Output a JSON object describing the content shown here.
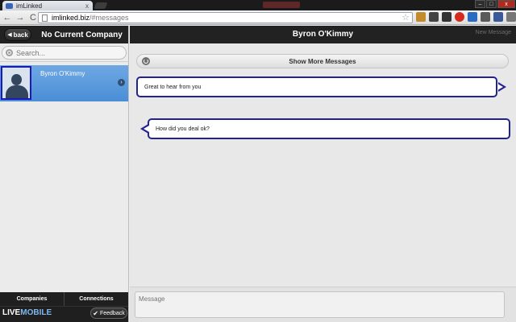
{
  "browser": {
    "tab_title": "imLinked",
    "tab_close": "x",
    "url_host": "imlinked.biz",
    "url_path": "/#messages",
    "window_controls": {
      "minimize": "–",
      "maximize": "□",
      "close": "x"
    },
    "nav": {
      "back": "←",
      "forward": "→",
      "reload": "C"
    },
    "star": "☆"
  },
  "sidebar": {
    "back_label": "back",
    "title": "No Current Company",
    "search_placeholder": "Search...",
    "contacts": [
      {
        "name": "Byron O'Kimmy",
        "chevron": "›"
      }
    ],
    "tabs": [
      "Companies",
      "Connections"
    ],
    "logo": {
      "part1": "LIVE",
      "part2": "MOBILE"
    },
    "feedback_label": "Feedback",
    "check": "✔"
  },
  "main": {
    "title": "Byron O'Kimmy",
    "new_message_label": "New Message",
    "show_more_label": "Show More Messages",
    "messages": [
      {
        "direction": "outgoing",
        "text": "Great to hear from you"
      },
      {
        "direction": "incoming",
        "text": "How did you deal ok?"
      }
    ],
    "compose_placeholder": "Message"
  },
  "colors": {
    "header_bg": "#222222",
    "selected_row": "#5b9ade",
    "bubble_border": "#232390"
  }
}
